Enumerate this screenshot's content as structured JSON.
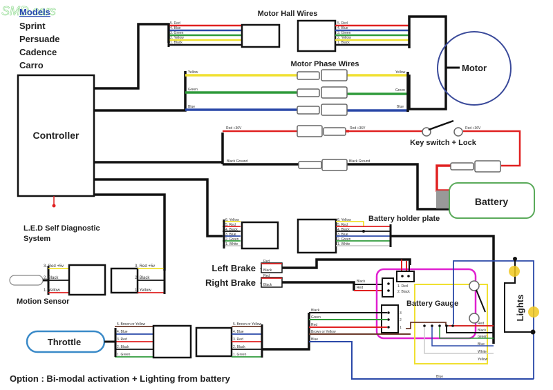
{
  "watermark": "SMD.cars",
  "models": {
    "heading": "Models",
    "items": [
      "Sprint",
      "Persuade",
      "Cadence",
      "Carro"
    ]
  },
  "labels": {
    "controller": "Controller",
    "motor": "Motor",
    "motor_hall_wires": "Motor Hall Wires",
    "motor_phase_wires": "Motor Phase Wires",
    "key_switch": "Key switch + Lock",
    "battery": "Battery",
    "battery_holder_plate": "Battery holder plate",
    "led_diagnostic": "L.E.D Self Diagnostic",
    "led_diagnostic_2": "System",
    "motion_sensor": "Motion Sensor",
    "left_brake": "Left Brake",
    "right_brake": "Right Brake",
    "battery_gauge": "Battery Gauge",
    "lights": "Lights",
    "throttle": "Throttle",
    "footer_option": "Option : Bi-modal activation + Lighting from battery"
  },
  "hall_wires": [
    "5. Red",
    "4. Blue",
    "3. Green",
    "2. Yellow",
    "1. Black"
  ],
  "phase_wires": [
    "Yellow",
    "Green",
    "Blue"
  ],
  "power_wires": {
    "red_left": "Red +36V",
    "red_mid": "Red +36V",
    "red_right": "Red +36V",
    "black_left": "Black  Ground",
    "black_mid": "Black  Ground"
  },
  "holder_wires": [
    "6. Yellow",
    "5. Red",
    "4. Black",
    "3. Blue",
    "2. Green",
    "1. White"
  ],
  "sensor_wires": [
    "3. Red +5v",
    "2. Black",
    "1. Yellow"
  ],
  "brake_wires": [
    "Red",
    "Black"
  ],
  "right_brake_out": [
    "Black",
    "Red"
  ],
  "gauge_pins_top": [
    "1. Red",
    "2. Black"
  ],
  "gauge_pins_side": [
    "3",
    "2",
    "1"
  ],
  "gauge_out_wires": [
    "Red",
    "Black",
    "Green",
    "Blue",
    "White",
    "Yellow"
  ],
  "throttle_wires": [
    "5. Brown or Yellow",
    "4. Blue",
    "3. Red",
    "2. Black",
    "1. Green"
  ],
  "throttle_out_wires": [
    "Black",
    "Green",
    "Red",
    "Brown or Yellow",
    "Blue"
  ],
  "lights_bottom_wire": "Blue",
  "colors": {
    "red": "#e02020",
    "blue": "#2a48a8",
    "green": "#2e9a3a",
    "yellow": "#f0e030",
    "black": "#111111",
    "white": "#d8d8d8",
    "brown": "#6b3a2a",
    "magenta": "#e020d0",
    "motor_circle": "#3a4a9a",
    "battery_border": "#5aaa5a",
    "throttle_border": "#3a8ac8",
    "lights_frame": "#5a6aa8",
    "bulb": "#f0c820",
    "heading_blue": "#2a4ab0"
  }
}
